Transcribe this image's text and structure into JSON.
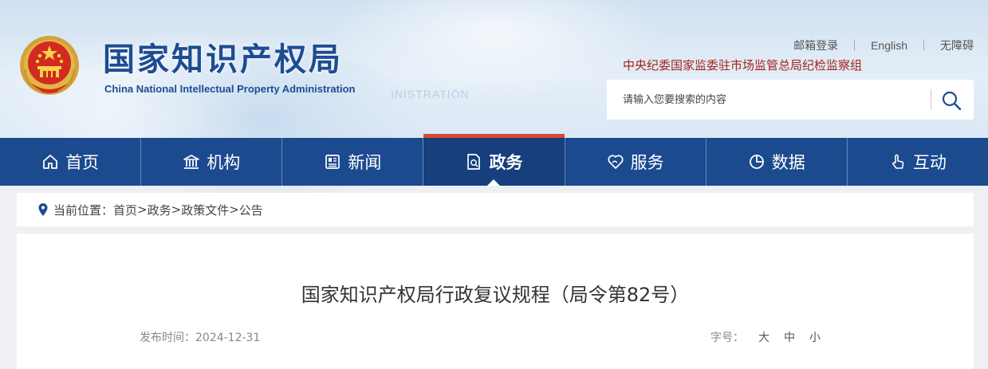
{
  "header": {
    "title_cn": "国家知识产权局",
    "title_en": "China National Intellectual Property Administration",
    "ghost_text": "INISTRATION",
    "links": {
      "mail": "邮箱登录",
      "english": "English",
      "accessibility": "无障碍"
    },
    "discipline_unit": "中央纪委国家监委驻市场监管总局纪检监察组",
    "search": {
      "placeholder": "请输入您要搜索的内容",
      "value": ""
    }
  },
  "nav": {
    "items": [
      {
        "label": "首页",
        "icon": "home-icon"
      },
      {
        "label": "机构",
        "icon": "institution-icon"
      },
      {
        "label": "新闻",
        "icon": "news-icon"
      },
      {
        "label": "政务",
        "icon": "government-affairs-icon",
        "active": true
      },
      {
        "label": "服务",
        "icon": "service-icon"
      },
      {
        "label": "数据",
        "icon": "pie-chart-icon"
      },
      {
        "label": "互动",
        "icon": "interaction-icon"
      }
    ]
  },
  "breadcrumb": {
    "prefix": "当前位置：",
    "items": [
      "首页",
      "政务",
      "政策文件",
      "公告"
    ],
    "separator": ">"
  },
  "article": {
    "title": "国家知识产权局行政复议规程（局令第82号）",
    "date_label": "发布时间：",
    "date": "2024-12-31",
    "font_size_label": "字号：",
    "font_sizes": [
      "大",
      "中",
      "小"
    ]
  },
  "colors": {
    "nav_background": "#1c4a8f",
    "title_blue": "#1d4c92",
    "active_accent": "#d84a32",
    "discipline_red": "#a4231c"
  }
}
